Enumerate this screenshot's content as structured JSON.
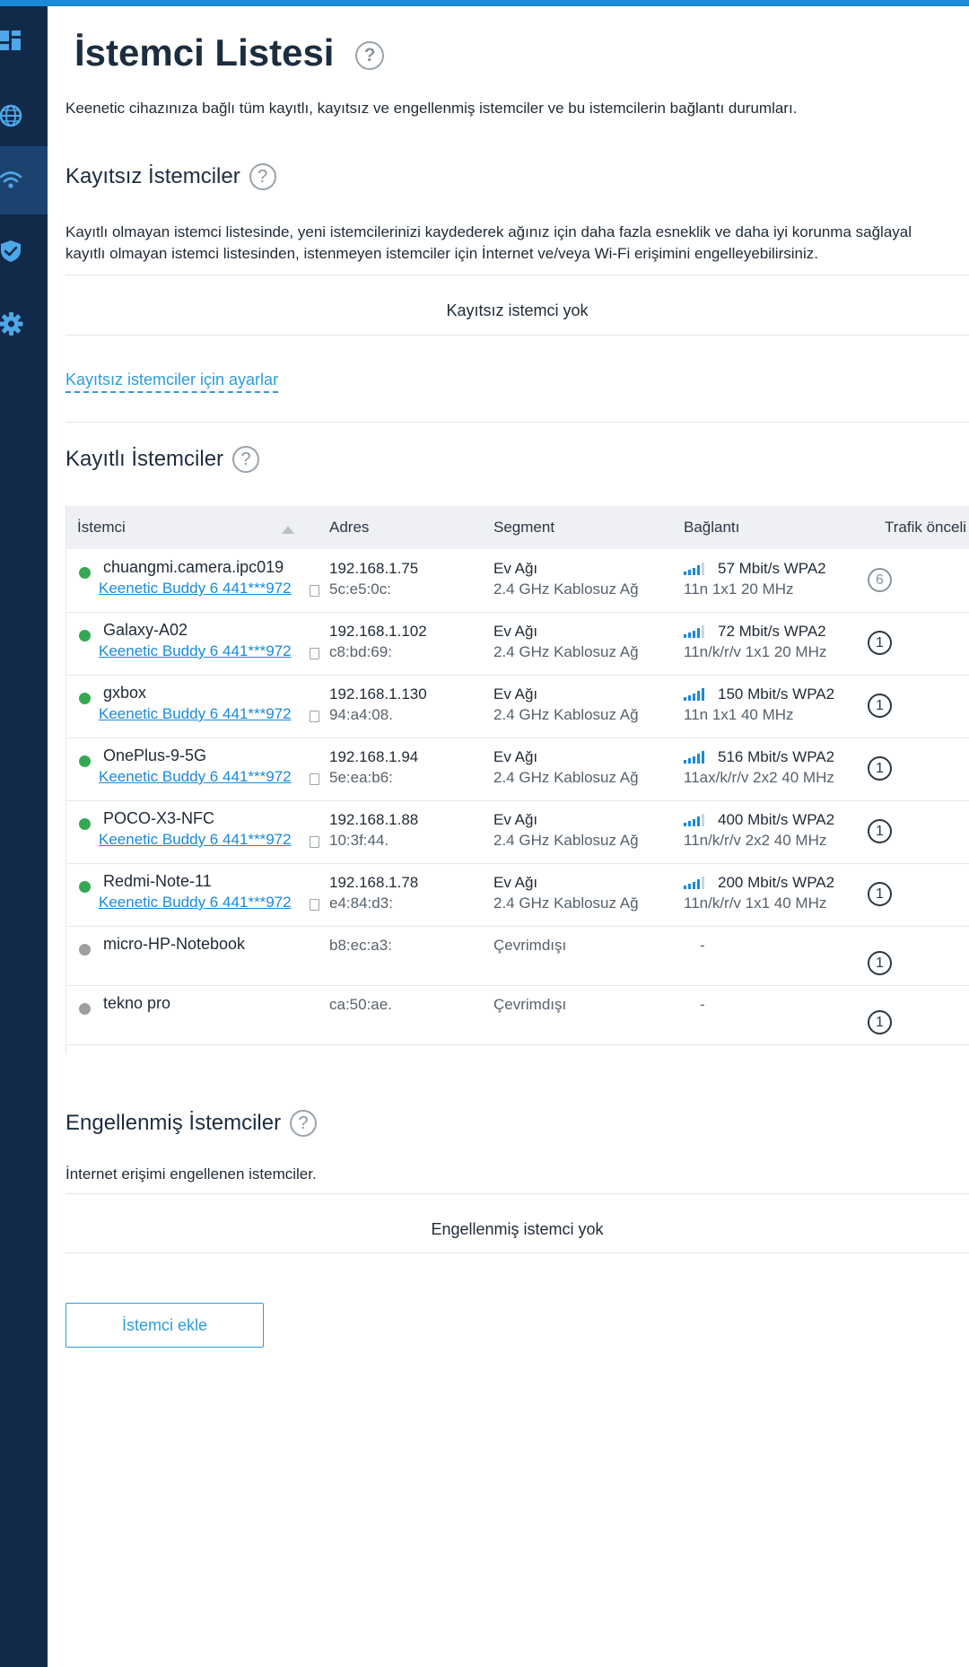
{
  "page": {
    "title": "İstemci Listesi",
    "help": "?",
    "description": "Keenetic cihazınıza bağlı tüm kayıtlı, kayıtsız ve engellenmiş istemciler ve bu istemcilerin bağlantı durumları."
  },
  "sidebar": {
    "items": [
      {
        "icon": "dashboard-icon",
        "active": false
      },
      {
        "icon": "globe-icon",
        "active": false
      },
      {
        "icon": "wifi-icon",
        "active": true
      },
      {
        "icon": "shield-icon",
        "active": false
      },
      {
        "icon": "gear-icon",
        "active": false
      }
    ]
  },
  "unregistered": {
    "title": "Kayıtsız İstemciler",
    "desc_line1": "Kayıtlı olmayan istemci listesinde, yeni istemcilerinizi kaydederek ağınız için daha fazla esneklik ve daha iyi korunma sağlayal",
    "desc_line2": "kayıtlı olmayan istemci listesinden, istenmeyen istemciler için İnternet ve/veya Wi-Fi erişimini engelleyebilirsiniz.",
    "empty": "Kayıtsız istemci yok",
    "settings_link": "Kayıtsız istemciler için ayarlar"
  },
  "registered": {
    "title": "Kayıtlı İstemciler",
    "columns": {
      "client": "İstemci",
      "address": "Adres",
      "segment": "Segment",
      "connection": "Bağlantı",
      "priority": "Trafik önceli"
    },
    "rows": [
      {
        "name": "chuangmi.camera.ipc019",
        "owner": "Keenetic Buddy 6 441***972",
        "online": true,
        "ip": "192.168.1.75",
        "mac": "5c:e5:0c:",
        "seg": "Ev Ağı",
        "band": "2.4 GHz Kablosuz Ağ",
        "signal": 4,
        "speed": "57 Mbit/s WPA2",
        "mode": "11n 1x1 20 MHz",
        "prio": "6",
        "prio_grey": true
      },
      {
        "name": "Galaxy-A02",
        "owner": "Keenetic Buddy 6 441***972",
        "online": true,
        "ip": "192.168.1.102",
        "mac": "c8:bd:69:",
        "seg": "Ev Ağı",
        "band": "2.4 GHz Kablosuz Ağ",
        "signal": 4,
        "speed": "72 Mbit/s WPA2",
        "mode": "11n/k/r/v 1x1 20 MHz",
        "prio": "1",
        "prio_grey": false
      },
      {
        "name": "gxbox",
        "owner": "Keenetic Buddy 6 441***972",
        "online": true,
        "ip": "192.168.1.130",
        "mac": "94:a4:08.",
        "seg": "Ev Ağı",
        "band": "2.4 GHz Kablosuz Ağ",
        "signal": 5,
        "speed": "150 Mbit/s WPA2",
        "mode": "11n 1x1 40 MHz",
        "prio": "1",
        "prio_grey": false
      },
      {
        "name": "OnePlus-9-5G",
        "owner": "Keenetic Buddy 6 441***972",
        "online": true,
        "ip": "192.168.1.94",
        "mac": "5e:ea:b6:",
        "seg": "Ev Ağı",
        "band": "2.4 GHz Kablosuz Ağ",
        "signal": 5,
        "speed": "516 Mbit/s WPA2",
        "mode": "11ax/k/r/v 2x2 40 MHz",
        "prio": "1",
        "prio_grey": false
      },
      {
        "name": "POCO-X3-NFC",
        "owner": "Keenetic Buddy 6 441***972",
        "online": true,
        "ip": "192.168.1.88",
        "mac": "10:3f:44.",
        "seg": "Ev Ağı",
        "band": "2.4 GHz Kablosuz Ağ",
        "signal": 4,
        "speed": "400 Mbit/s WPA2",
        "mode": "11n/k/r/v 2x2 40 MHz",
        "prio": "1",
        "prio_grey": false
      },
      {
        "name": "Redmi-Note-11",
        "owner": "Keenetic Buddy 6 441***972",
        "online": true,
        "ip": "192.168.1.78",
        "mac": "e4:84:d3:",
        "seg": "Ev Ağı",
        "band": "2.4 GHz Kablosuz Ağ",
        "signal": 4,
        "speed": "200 Mbit/s WPA2",
        "mode": "11n/k/r/v 1x1 40 MHz",
        "prio": "1",
        "prio_grey": false
      },
      {
        "name": "micro-HP-Notebook",
        "owner": "",
        "online": false,
        "ip": "",
        "mac": "b8:ec:a3:",
        "seg": "Çevrimdışı",
        "band": "",
        "signal": 0,
        "speed": "-",
        "mode": "",
        "prio": "1",
        "prio_grey": false
      },
      {
        "name": "tekno pro",
        "owner": "",
        "online": false,
        "ip": "",
        "mac": "ca:50:ae.",
        "seg": "Çevrimdışı",
        "band": "",
        "signal": 0,
        "speed": "-",
        "mode": "",
        "prio": "1",
        "prio_grey": false
      }
    ]
  },
  "blocked": {
    "title": "Engellenmiş İstemciler",
    "desc": "İnternet erişimi engellenen istemciler.",
    "empty": "Engellenmiş istemci yok"
  },
  "actions": {
    "add_client": "İstemci ekle"
  },
  "colors": {
    "accent": "#1a8ad8",
    "sidebar": "#122a4a",
    "online": "#34a853",
    "offline": "#9e9e9e"
  }
}
